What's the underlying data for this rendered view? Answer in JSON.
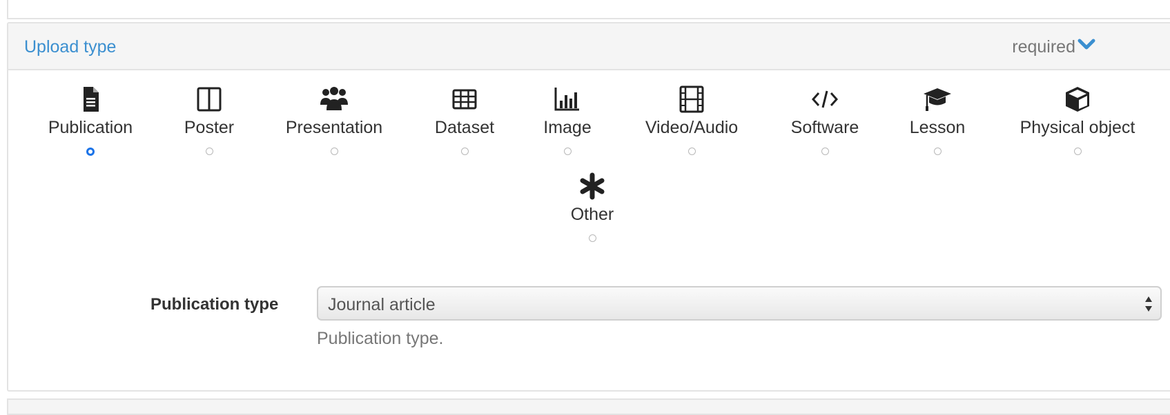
{
  "panel": {
    "title": "Upload type",
    "required_label": "required"
  },
  "upload_types": [
    {
      "label": "Publication",
      "icon": "file-text-icon",
      "selected": true
    },
    {
      "label": "Poster",
      "icon": "columns-icon",
      "selected": false
    },
    {
      "label": "Presentation",
      "icon": "group-icon",
      "selected": false
    },
    {
      "label": "Dataset",
      "icon": "table-icon",
      "selected": false
    },
    {
      "label": "Image",
      "icon": "bar-chart-icon",
      "selected": false
    },
    {
      "label": "Video/Audio",
      "icon": "film-icon",
      "selected": false
    },
    {
      "label": "Software",
      "icon": "code-icon",
      "selected": false
    },
    {
      "label": "Lesson",
      "icon": "graduation-cap-icon",
      "selected": false
    },
    {
      "label": "Physical object",
      "icon": "cube-icon",
      "selected": false
    },
    {
      "label": "Other",
      "icon": "asterisk-icon",
      "selected": false
    }
  ],
  "publication_type": {
    "label": "Publication type",
    "selected_value": "Journal article",
    "help_text": "Publication type."
  },
  "colors": {
    "accent": "#3b8fd0",
    "radio_selected": "#1a73e8",
    "border": "#e3e3e3",
    "heading_bg": "#f5f5f5"
  }
}
